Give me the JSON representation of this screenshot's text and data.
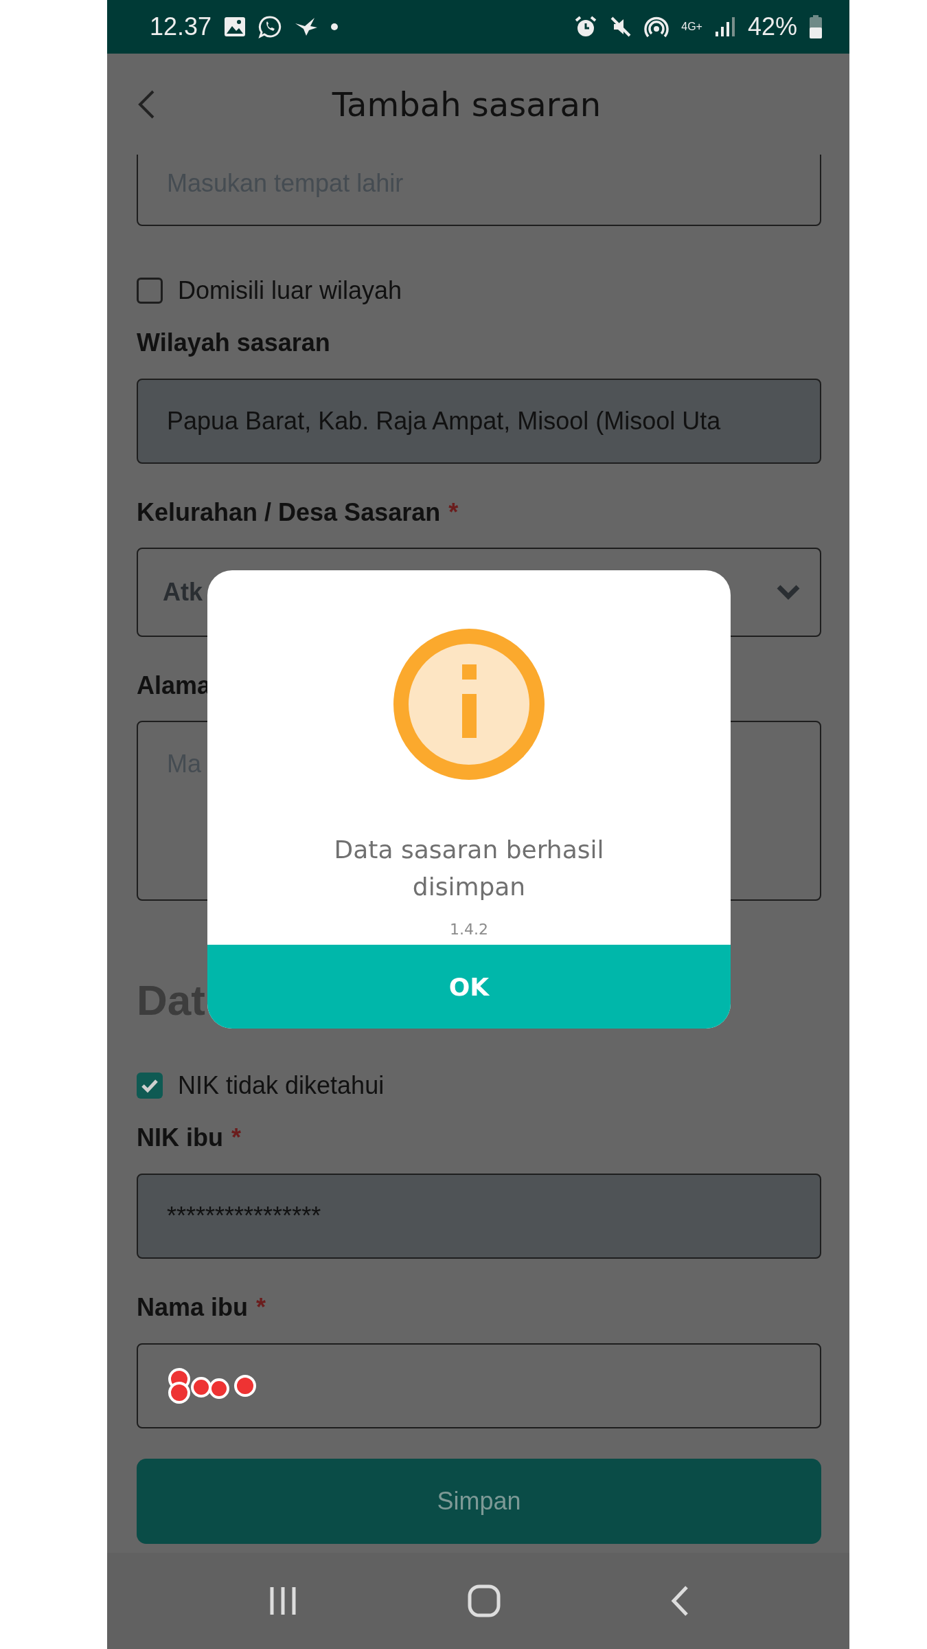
{
  "status_bar": {
    "time": "12.37",
    "network": "4G+",
    "battery": "42%"
  },
  "header": {
    "title": "Tambah sasaran"
  },
  "form": [
    {
      "kind": "input",
      "placeholder": "Masukan tempat lahir",
      "disabled": false
    },
    {
      "kind": "checkbox",
      "label": "Domisili luar wilayah",
      "checked": false
    },
    {
      "kind": "label",
      "text": "Wilayah sasaran"
    },
    {
      "kind": "input",
      "value": "Papua Barat, Kab. Raja Ampat, Misool (Misool Uta",
      "disabled": true
    },
    {
      "kind": "label",
      "text": "Kelurahan / Desa Sasaran",
      "required_mark": "*"
    },
    {
      "kind": "select",
      "value": "Atk"
    },
    {
      "kind": "label",
      "text": "Alama"
    },
    {
      "kind": "textarea",
      "placeholder": "Ma"
    },
    {
      "kind": "heading",
      "text": "Dat"
    },
    {
      "kind": "checkbox",
      "label": "NIK tidak diketahui",
      "checked": true
    },
    {
      "kind": "label",
      "text": "NIK ibu",
      "required_mark": "*"
    },
    {
      "kind": "input",
      "value": "****************",
      "disabled": true
    },
    {
      "kind": "label",
      "text": "Nama ibu",
      "required_mark": "*"
    },
    {
      "kind": "input",
      "redacted": true,
      "disabled": false
    }
  ],
  "save_button": {
    "label": "Simpan",
    "disabled": true
  },
  "dialog": {
    "message": "Data sasaran berhasil disimpan",
    "version": "1.4.2",
    "button": "OK"
  }
}
